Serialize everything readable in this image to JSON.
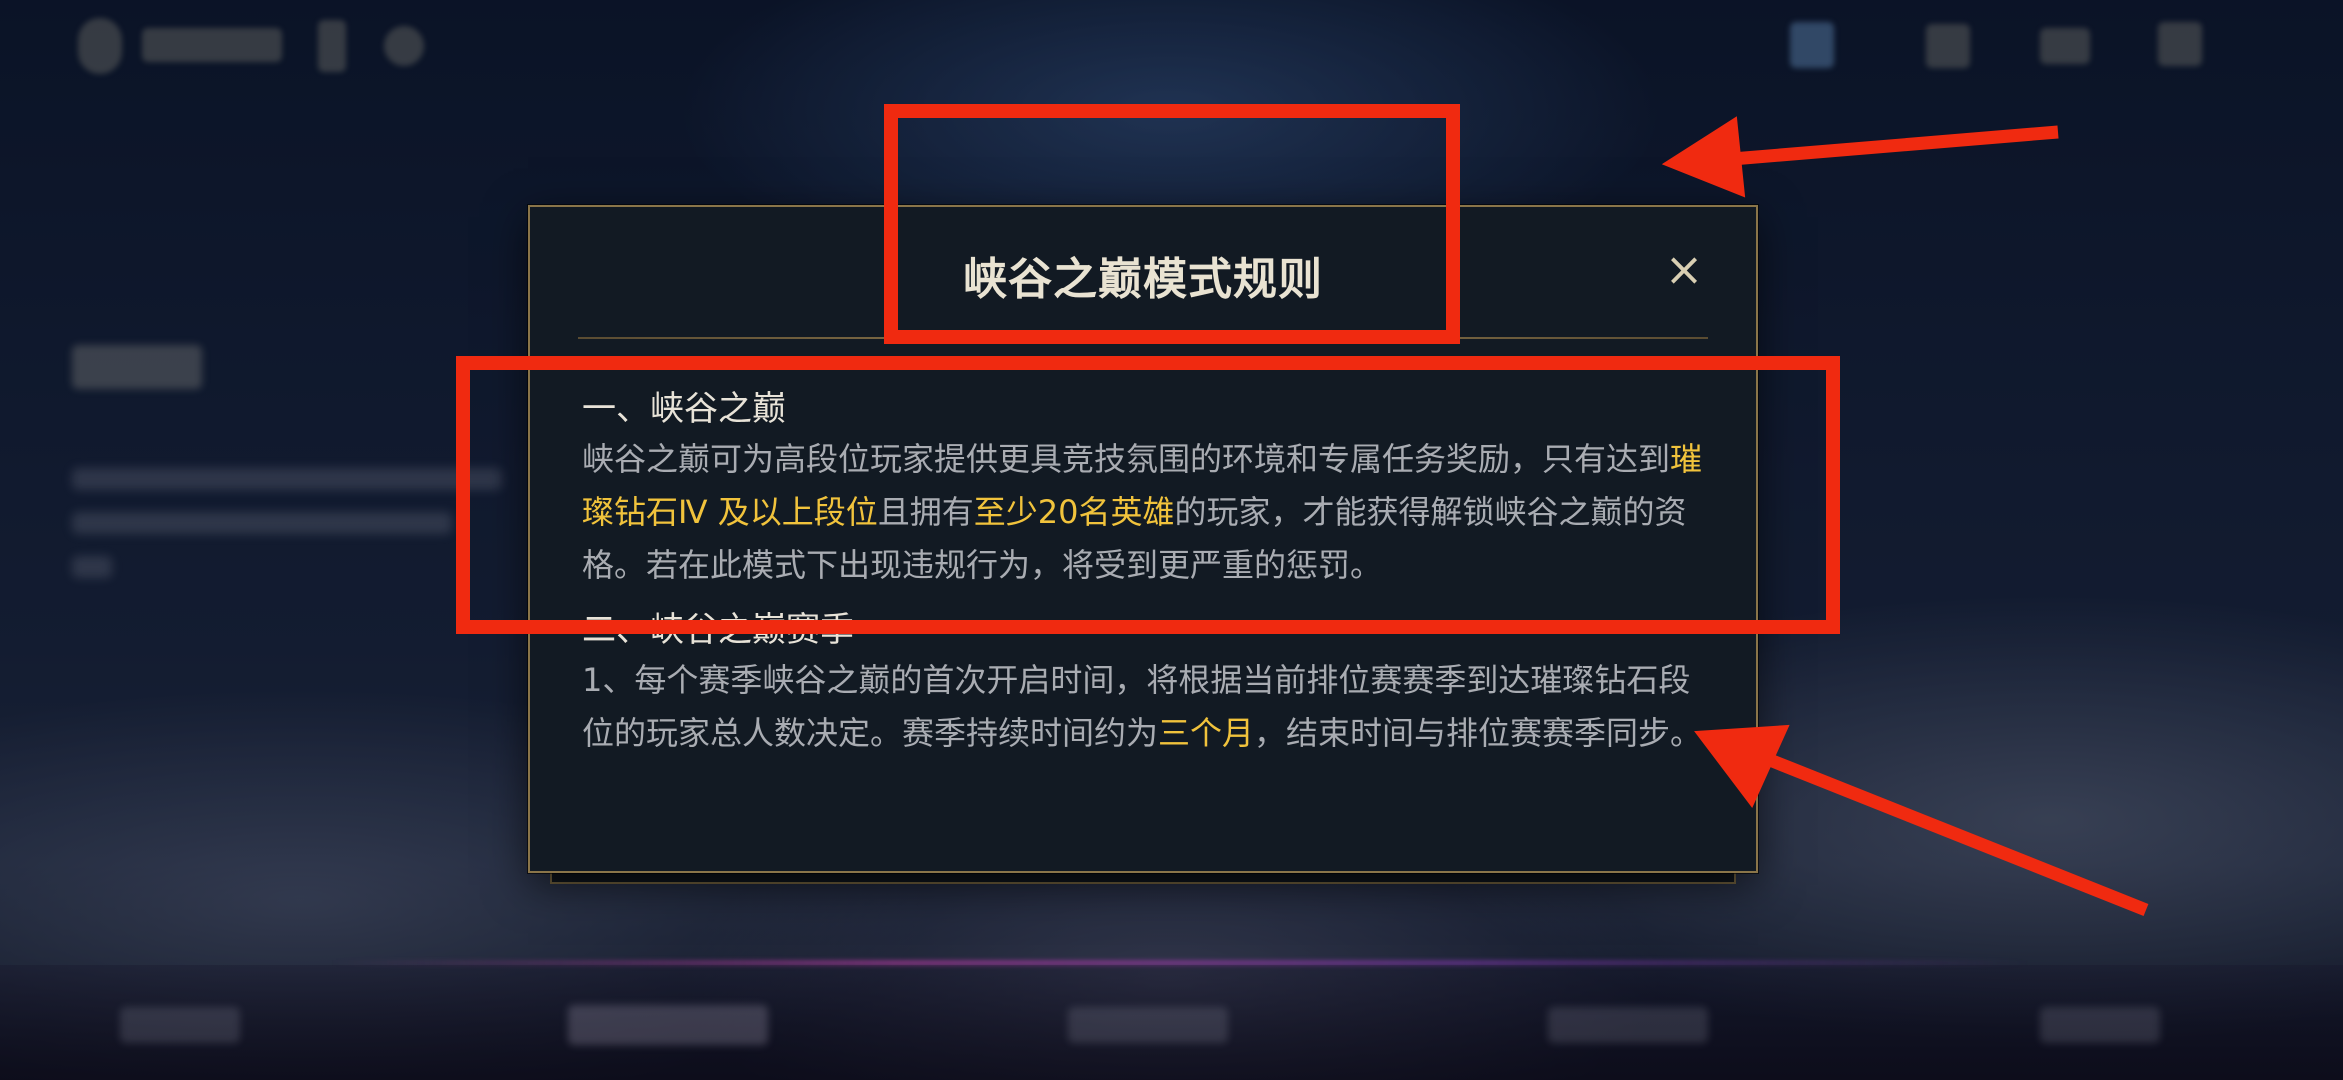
{
  "dialog": {
    "title": "峡谷之巅模式规则",
    "close_label": "×",
    "sections": [
      {
        "heading": "一、峡谷之巅",
        "text_1": "峡谷之巅可为高段位玩家提供更具竞技氛围的环境和专属任务奖励，只有达到",
        "highlight_1": "璀璨钻石Ⅳ 及以上段位",
        "text_2": "且拥有",
        "highlight_2": "至少20名英雄",
        "text_3": "的玩家，才能获得解锁峡谷之巅的资格。若在此模式下出现违规行为，将受到更严重的惩罚。"
      },
      {
        "heading": "二、峡谷之巅赛季",
        "text_1": "1、每个赛季峡谷之巅的首次开启时间，将根据当前排位赛赛季到达璀璨钻石段位的玩家总人数决定。赛季持续时间约为",
        "highlight_1": "三个月",
        "text_2": "，结束时间与排位赛赛季同步。"
      }
    ]
  },
  "colors": {
    "highlight": "#f1c33c",
    "annotation_red": "#f02a10",
    "dialog_border": "#8a7549"
  }
}
